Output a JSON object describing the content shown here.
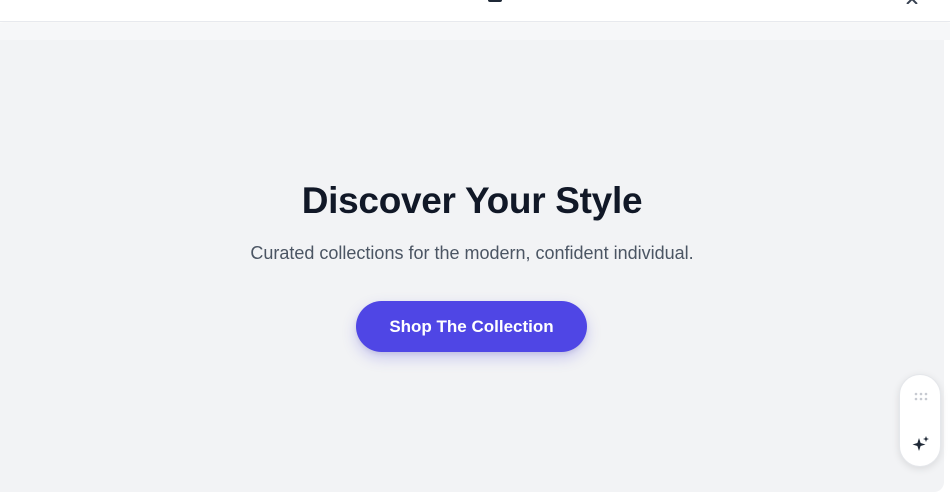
{
  "hero": {
    "title": "Discover Your Style",
    "subtitle": "Curated collections for the modern, confident individual.",
    "cta_label": "Shop The Collection"
  },
  "colors": {
    "accent": "#4f46e5",
    "hero_background": "#f2f3f5",
    "title_text": "#111827",
    "subtitle_text": "#4b5563"
  },
  "widget": {
    "handle_icon": "drag-dots-icon",
    "action_icon": "sparkle-icon"
  }
}
